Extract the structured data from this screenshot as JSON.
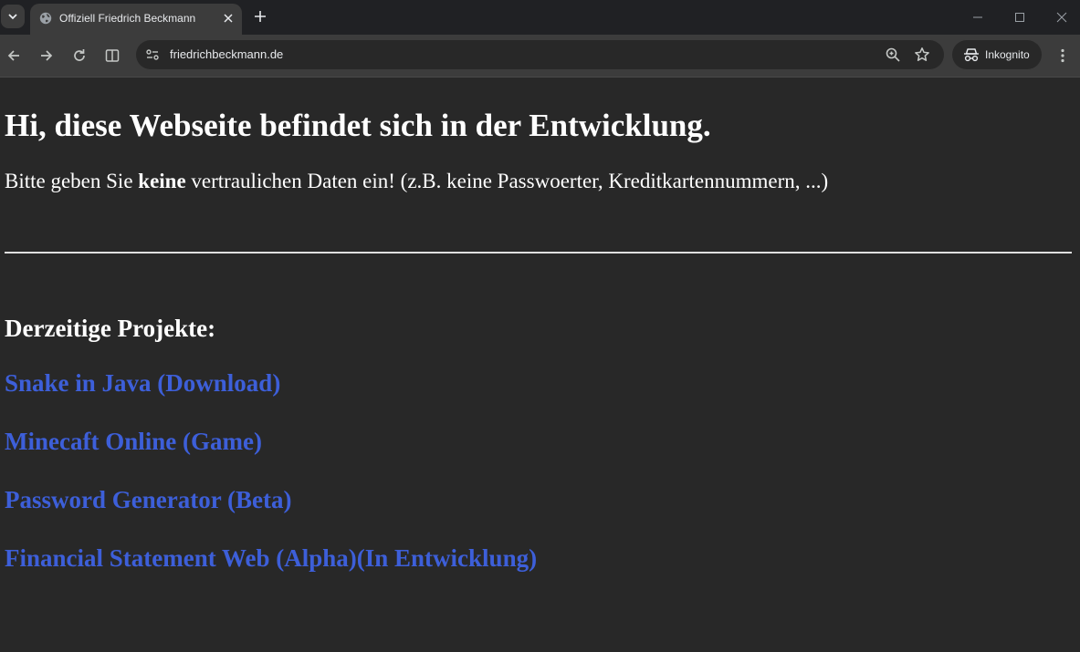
{
  "browser": {
    "tab_title": "Offiziell Friedrich Beckmann",
    "url": "friedrichbeckmann.de",
    "incognito_label": "Inkognito"
  },
  "page": {
    "heading": "Hi, diese Webseite befindet sich in der Entwicklung.",
    "notice_before": "Bitte geben Sie ",
    "notice_bold": "keine",
    "notice_after": " vertraulichen Daten ein! (z.B. keine Passwoerter, Kreditkartennummern, ...)",
    "projects_heading": "Derzeitige Projekte:",
    "projects": [
      "Snake in Java (Download)",
      "Minecaft Online (Game)",
      "Password Generator (Beta)",
      "Financial Statement Web (Alpha)(In Entwicklung)"
    ]
  },
  "colors": {
    "page_background": "#282828",
    "text": "#ffffff",
    "link": "#3d5fd9"
  },
  "icons": [
    "tab-search-icon",
    "globe-icon",
    "close-icon",
    "plus-icon",
    "minimize-icon",
    "maximize-icon",
    "window-close-icon",
    "back-arrow-icon",
    "forward-arrow-icon",
    "reload-icon",
    "split-view-icon",
    "site-info-icon",
    "zoom-icon",
    "star-icon",
    "incognito-icon",
    "more-vert-icon"
  ]
}
